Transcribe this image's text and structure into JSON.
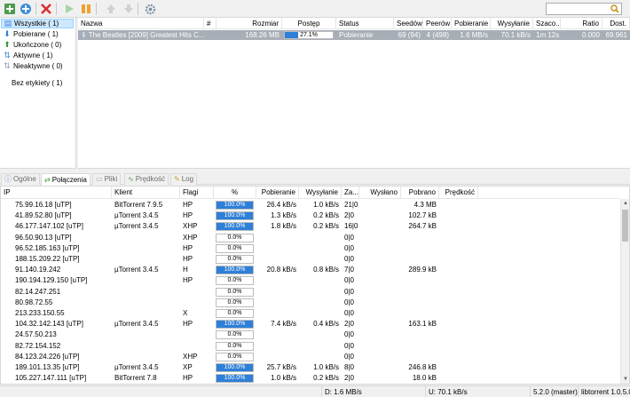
{
  "toolbar": {
    "search": {
      "value": "",
      "placeholder": ""
    }
  },
  "sidebar": {
    "items": [
      {
        "label": "Wszystkie ( 1)"
      },
      {
        "label": "Pobierane ( 1)"
      },
      {
        "label": "Ukończone ( 0)"
      },
      {
        "label": "Aktywne ( 1)"
      },
      {
        "label": "Nieaktywne ( 0)"
      }
    ],
    "label_item": "Bez etykiety ( 1)"
  },
  "torrents": {
    "columns": [
      "Nazwa",
      "#",
      "Rozmiar",
      "Postęp",
      "Status",
      "Seedów",
      "Peerów",
      "Pobieranie",
      "Wysyłanie",
      "Szaco...",
      "Ratio",
      "Dost."
    ],
    "rows": [
      {
        "name": "The Beatles [2009] Greatest Hits C...",
        "num": "",
        "size": "168.26 MB",
        "progress_text": "27.1%",
        "progress": 27.1,
        "status": "Pobieranie",
        "seeds": "69 (94)",
        "peers": "4 (498)",
        "down": "1.6 MB/s",
        "up": "70.1 kB/s",
        "eta": "1m 12s",
        "ratio": "0.000",
        "avail": "69.961"
      }
    ]
  },
  "tabs": [
    {
      "label": "Ogólne",
      "icon": "info-icon"
    },
    {
      "label": "Połączenia",
      "icon": "peers-icon"
    },
    {
      "label": "Pliki",
      "icon": "files-icon"
    },
    {
      "label": "Prędkość",
      "icon": "speed-icon"
    },
    {
      "label": "Log",
      "icon": "log-icon"
    }
  ],
  "peers": {
    "columns": [
      "IP",
      "Klient",
      "Flagi",
      "%",
      "Pobieranie",
      "Wysyłanie",
      "Za...",
      "Wysłano",
      "Pobrano",
      "Prędkość"
    ],
    "rows": [
      {
        "ip": "75.99.16.18 [uTP]",
        "client": "BitTorrent 7.9.5",
        "flags": "HP",
        "pct": "100.0%",
        "p": 100,
        "down": "26.4 kB/s",
        "up": "1.0 kB/s",
        "za": "21|0",
        "sent": "",
        "recv": "4.3 MB",
        "speed": ""
      },
      {
        "ip": "41.89.52.80 [uTP]",
        "client": "µTorrent 3.4.5",
        "flags": "HP",
        "pct": "100.0%",
        "p": 100,
        "down": "1.3 kB/s",
        "up": "0.2 kB/s",
        "za": "2|0",
        "sent": "",
        "recv": "102.7 kB",
        "speed": ""
      },
      {
        "ip": "46.177.147.102 [uTP]",
        "client": "µTorrent 3.4.5",
        "flags": "XHP",
        "pct": "100.0%",
        "p": 100,
        "down": "1.8 kB/s",
        "up": "0.2 kB/s",
        "za": "16|0",
        "sent": "",
        "recv": "264.7 kB",
        "speed": ""
      },
      {
        "ip": "96.50.90.13 [uTP]",
        "client": "",
        "flags": "XHP",
        "pct": "0.0%",
        "p": 0,
        "down": "",
        "up": "",
        "za": "0|0",
        "sent": "",
        "recv": "",
        "speed": ""
      },
      {
        "ip": "96.52.185.163 [uTP]",
        "client": "",
        "flags": "HP",
        "pct": "0.0%",
        "p": 0,
        "down": "",
        "up": "",
        "za": "0|0",
        "sent": "",
        "recv": "",
        "speed": ""
      },
      {
        "ip": "188.15.209.22 [uTP]",
        "client": "",
        "flags": "HP",
        "pct": "0.0%",
        "p": 0,
        "down": "",
        "up": "",
        "za": "0|0",
        "sent": "",
        "recv": "",
        "speed": ""
      },
      {
        "ip": "91.140.19.242",
        "client": "µTorrent 3.4.5",
        "flags": "H",
        "pct": "100.0%",
        "p": 100,
        "down": "20.8 kB/s",
        "up": "0.8 kB/s",
        "za": "7|0",
        "sent": "",
        "recv": "289.9 kB",
        "speed": ""
      },
      {
        "ip": "190.194.129.150 [uTP]",
        "client": "",
        "flags": "HP",
        "pct": "0.0%",
        "p": 0,
        "down": "",
        "up": "",
        "za": "0|0",
        "sent": "",
        "recv": "",
        "speed": ""
      },
      {
        "ip": "82.14.247.251",
        "client": "",
        "flags": "",
        "pct": "0.0%",
        "p": 0,
        "down": "",
        "up": "",
        "za": "0|0",
        "sent": "",
        "recv": "",
        "speed": ""
      },
      {
        "ip": "80.98.72.55",
        "client": "",
        "flags": "",
        "pct": "0.0%",
        "p": 0,
        "down": "",
        "up": "",
        "za": "0|0",
        "sent": "",
        "recv": "",
        "speed": ""
      },
      {
        "ip": "213.233.150.55",
        "client": "",
        "flags": "X",
        "pct": "0.0%",
        "p": 0,
        "down": "",
        "up": "",
        "za": "0|0",
        "sent": "",
        "recv": "",
        "speed": ""
      },
      {
        "ip": "104.32.142.143 [uTP]",
        "client": "µTorrent 3.4.5",
        "flags": "HP",
        "pct": "100.0%",
        "p": 100,
        "down": "7.4 kB/s",
        "up": "0.4 kB/s",
        "za": "2|0",
        "sent": "",
        "recv": "163.1 kB",
        "speed": ""
      },
      {
        "ip": "24.57.50.213",
        "client": "",
        "flags": "",
        "pct": "0.0%",
        "p": 0,
        "down": "",
        "up": "",
        "za": "0|0",
        "sent": "",
        "recv": "",
        "speed": ""
      },
      {
        "ip": "82.72.154.152",
        "client": "",
        "flags": "",
        "pct": "0.0%",
        "p": 0,
        "down": "",
        "up": "",
        "za": "0|0",
        "sent": "",
        "recv": "",
        "speed": ""
      },
      {
        "ip": "84.123.24.226 [uTP]",
        "client": "",
        "flags": "XHP",
        "pct": "0.0%",
        "p": 0,
        "down": "",
        "up": "",
        "za": "0|0",
        "sent": "",
        "recv": "",
        "speed": ""
      },
      {
        "ip": "189.101.13.35 [uTP]",
        "client": "µTorrent 3.4.5",
        "flags": "XP",
        "pct": "100.0%",
        "p": 100,
        "down": "25.7 kB/s",
        "up": "1.0 kB/s",
        "za": "8|0",
        "sent": "",
        "recv": "246.8 kB",
        "speed": ""
      },
      {
        "ip": "105.227.147.111 [uTP]",
        "client": "BitTorrent 7.8",
        "flags": "HP",
        "pct": "100.0%",
        "p": 100,
        "down": "1.0 kB/s",
        "up": "0.2 kB/s",
        "za": "2|0",
        "sent": "",
        "recv": "18.0 kB",
        "speed": ""
      }
    ]
  },
  "statusbar": {
    "down": "D: 1.6 MB/s",
    "up": "U: 70.1 kB/s",
    "version": "5.2.0 (master)",
    "lib": "libtorrent 1.0.5.0"
  },
  "colors": {
    "progress": "#2e7fd8",
    "selected_row": "#a7aeb6",
    "sidebar_selected": "#cde8ff"
  }
}
